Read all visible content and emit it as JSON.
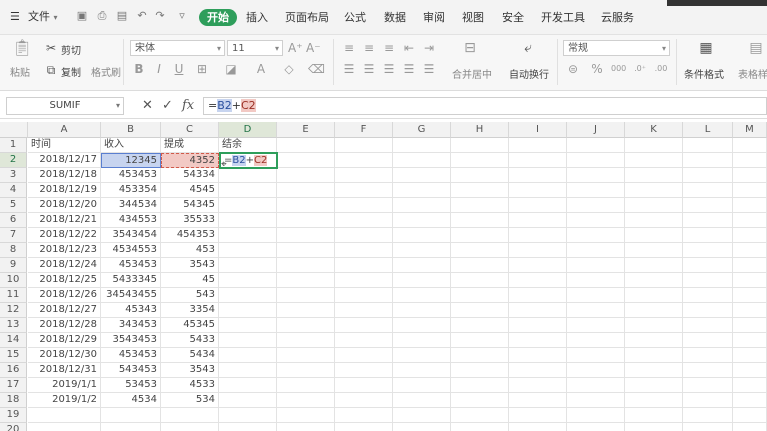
{
  "menubar": {
    "file_label": "文件",
    "tabs": [
      "开始",
      "插入",
      "页面布局",
      "公式",
      "数据",
      "审阅",
      "视图",
      "安全",
      "开发工具",
      "云服务"
    ],
    "active_tab": "开始"
  },
  "ribbon": {
    "paste": "粘贴",
    "cut": "剪切",
    "copy": "复制",
    "format_painter": "格式刷",
    "font_name": "宋体",
    "font_size": "11",
    "merge": "合并居中",
    "wrap": "自动换行",
    "number_format": "常规",
    "cond_format": "条件格式",
    "table_style": "表格样式",
    "bold": "B",
    "italic": "I",
    "underline": "U"
  },
  "formula_bar": {
    "name_box": "SUMIF",
    "cancel": "✕",
    "accept": "✓",
    "fx": "fx",
    "formula_prefix": "=",
    "ref1": "B2",
    "op": "+",
    "ref2": "C2"
  },
  "sheet": {
    "columns": [
      "A",
      "B",
      "C",
      "D",
      "E",
      "F",
      "G",
      "H",
      "I",
      "J",
      "K",
      "L",
      "M"
    ],
    "active_column": "D",
    "active_row": "2",
    "headers": [
      "时间",
      "收入",
      "提成",
      "结余"
    ],
    "rows": [
      [
        "2018/12/17",
        "12345",
        "4352"
      ],
      [
        "2018/12/18",
        "453453",
        "54334"
      ],
      [
        "2018/12/19",
        "453354",
        "4545"
      ],
      [
        "2018/12/20",
        "344534",
        "54345"
      ],
      [
        "2018/12/21",
        "434553",
        "35533"
      ],
      [
        "2018/12/22",
        "3543454",
        "454353"
      ],
      [
        "2018/12/23",
        "4534553",
        "453"
      ],
      [
        "2018/12/24",
        "453453",
        "3543"
      ],
      [
        "2018/12/25",
        "5433345",
        "45"
      ],
      [
        "2018/12/26",
        "34543455",
        "543"
      ],
      [
        "2018/12/27",
        "45343",
        "3354"
      ],
      [
        "2018/12/28",
        "343453",
        "45345"
      ],
      [
        "2018/12/29",
        "3543453",
        "5433"
      ],
      [
        "2018/12/30",
        "453453",
        "5434"
      ],
      [
        "2018/12/31",
        "543453",
        "3543"
      ],
      [
        "2019/1/1",
        "53453",
        "4533"
      ],
      [
        "2019/1/2",
        "4534",
        "534"
      ]
    ],
    "row_numbers": [
      "1",
      "2",
      "3",
      "4",
      "5",
      "6",
      "7",
      "8",
      "9",
      "10",
      "11",
      "12",
      "13",
      "14",
      "15",
      "16",
      "17",
      "18",
      "19",
      "20"
    ],
    "editing_formula": {
      "prefix": "=",
      "ref1": "B2",
      "op": "+",
      "ref2": "C2"
    }
  },
  "colors": {
    "accent_green": "#2e9e5b",
    "ref_b_fill": "#c7d4ef",
    "ref_c_fill": "#f2c9c4",
    "active_border": "#2e9e5b"
  }
}
